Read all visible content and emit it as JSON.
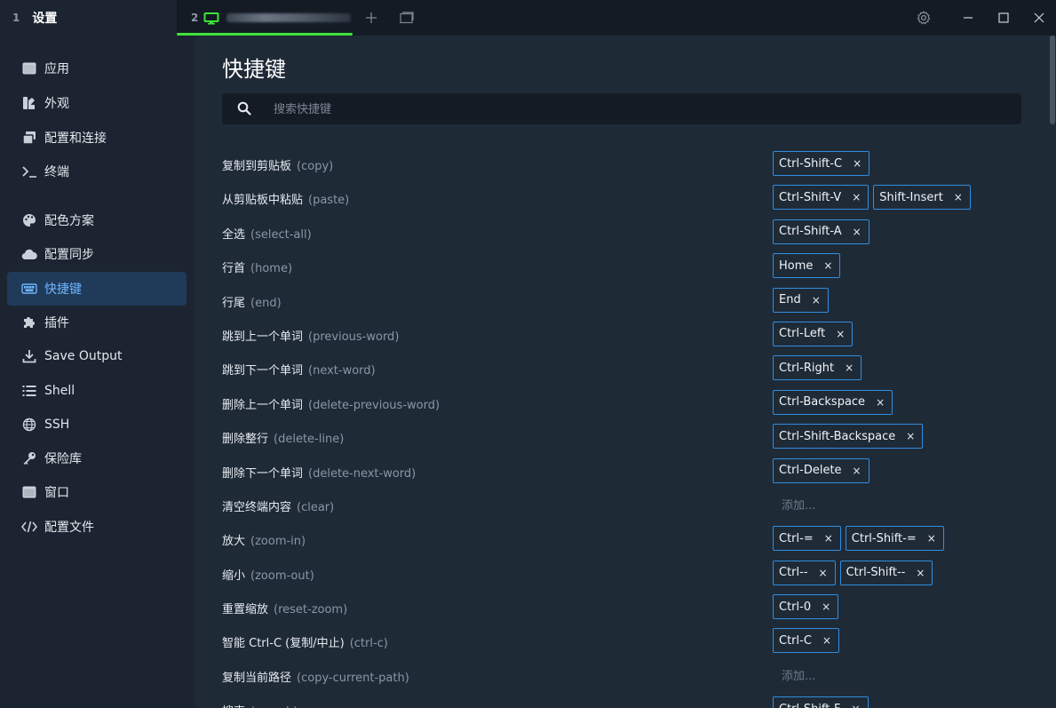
{
  "tabs": [
    {
      "number": "1",
      "title": "设置"
    },
    {
      "number": "2"
    }
  ],
  "sidebar": {
    "items": [
      {
        "label": "应用",
        "icon": "app-icon"
      },
      {
        "label": "外观",
        "icon": "paint-brush-icon"
      },
      {
        "label": "配置和连接",
        "icon": "window-stack-icon"
      },
      {
        "label": "终端",
        "icon": "terminal-icon"
      },
      {
        "label": "配色方案",
        "icon": "palette-icon"
      },
      {
        "label": "配置同步",
        "icon": "cloud-icon"
      },
      {
        "label": "快捷键",
        "icon": "keyboard-icon",
        "active": true
      },
      {
        "label": "插件",
        "icon": "puzzle-icon"
      },
      {
        "label": "Save Output",
        "icon": "download-icon"
      },
      {
        "label": "Shell",
        "icon": "list-icon"
      },
      {
        "label": "SSH",
        "icon": "globe-icon"
      },
      {
        "label": "保险库",
        "icon": "key-icon"
      },
      {
        "label": "窗口",
        "icon": "window-icon"
      },
      {
        "label": "配置文件",
        "icon": "code-icon"
      }
    ]
  },
  "main": {
    "title": "快捷键",
    "search_placeholder": "搜索快捷键",
    "add_placeholder": "添加...",
    "rows": [
      {
        "name": "复制到剪贴板",
        "id": "(copy)",
        "keys": [
          "Ctrl-Shift-C"
        ]
      },
      {
        "name": "从剪贴板中粘贴",
        "id": "(paste)",
        "keys": [
          "Ctrl-Shift-V",
          "Shift-Insert"
        ]
      },
      {
        "name": "全选",
        "id": "(select-all)",
        "keys": [
          "Ctrl-Shift-A"
        ]
      },
      {
        "name": "行首",
        "id": "(home)",
        "keys": [
          "Home"
        ]
      },
      {
        "name": "行尾",
        "id": "(end)",
        "keys": [
          "End"
        ]
      },
      {
        "name": "跳到上一个单词",
        "id": "(previous-word)",
        "keys": [
          "Ctrl-Left"
        ]
      },
      {
        "name": "跳到下一个单词",
        "id": "(next-word)",
        "keys": [
          "Ctrl-Right"
        ]
      },
      {
        "name": "删除上一个单词",
        "id": "(delete-previous-word)",
        "keys": [
          "Ctrl-Backspace"
        ]
      },
      {
        "name": "删除整行",
        "id": "(delete-line)",
        "keys": [
          "Ctrl-Shift-Backspace"
        ]
      },
      {
        "name": "删除下一个单词",
        "id": "(delete-next-word)",
        "keys": [
          "Ctrl-Delete"
        ]
      },
      {
        "name": "清空终端内容",
        "id": "(clear)",
        "keys": []
      },
      {
        "name": "放大",
        "id": "(zoom-in)",
        "keys": [
          "Ctrl-=",
          "Ctrl-Shift-="
        ]
      },
      {
        "name": "缩小",
        "id": "(zoom-out)",
        "keys": [
          "Ctrl--",
          "Ctrl-Shift--"
        ]
      },
      {
        "name": "重置缩放",
        "id": "(reset-zoom)",
        "keys": [
          "Ctrl-0"
        ]
      },
      {
        "name": "智能 Ctrl-C (复制/中止)",
        "id": "(ctrl-c)",
        "keys": [
          "Ctrl-C"
        ]
      },
      {
        "name": "复制当前路径",
        "id": "(copy-current-path)",
        "keys": []
      },
      {
        "name": "搜索",
        "id": "(search)",
        "keys": [
          "Ctrl-Shift-F"
        ]
      }
    ]
  },
  "colors": {
    "accent": "#2f8ee0",
    "active_tab_indicator": "#3ee43b",
    "sidebar_active_bg": "#203a59"
  }
}
